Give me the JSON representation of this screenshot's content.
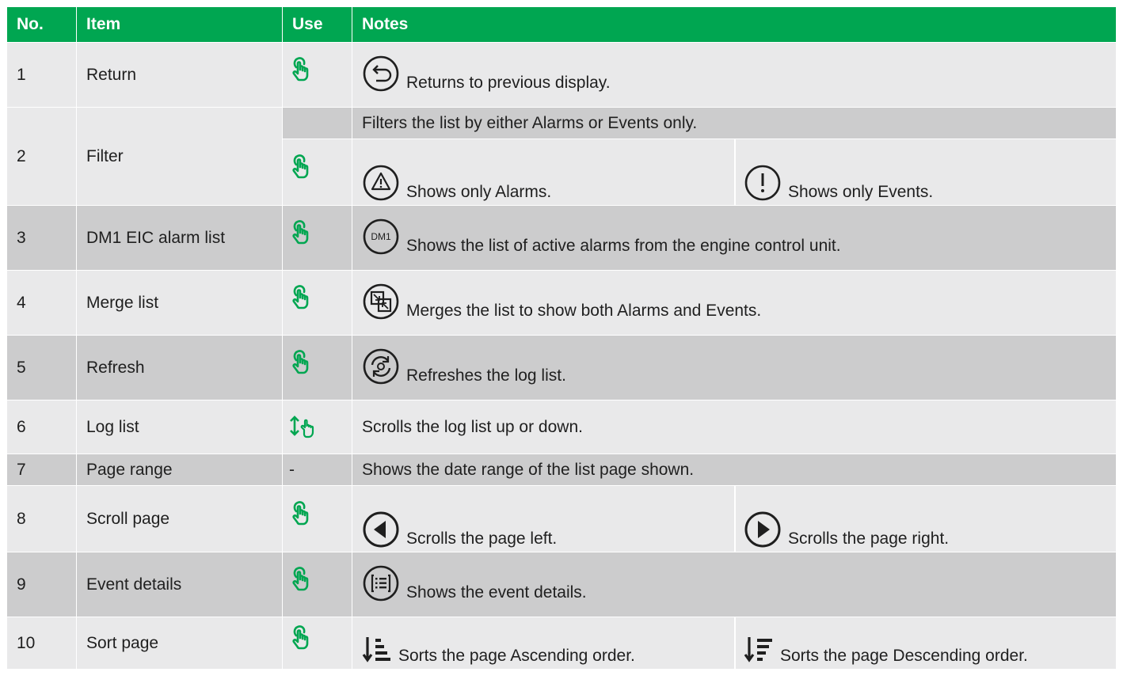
{
  "headers": {
    "no": "No.",
    "item": "Item",
    "use": "Use",
    "notes": "Notes"
  },
  "rows": {
    "r1": {
      "no": "1",
      "item": "Return",
      "use_icon": "tap-icon",
      "note_icon": "return-icon",
      "note": "Returns to previous display."
    },
    "r2": {
      "no": "2",
      "item": "Filter",
      "note_top": "Filters the list by either Alarms or Events only.",
      "use_icon": "tap-icon",
      "note_left_icon": "alarm-triangle-icon",
      "note_left": "Shows only Alarms.",
      "note_right_icon": "event-exclamation-icon",
      "note_right": "Shows only Events."
    },
    "r3": {
      "no": "3",
      "item": "DM1 EIC alarm list",
      "use_icon": "tap-icon",
      "note_icon": "dm1-icon",
      "icon_text": "DM1",
      "note": "Shows the list of active alarms from the engine control unit."
    },
    "r4": {
      "no": "4",
      "item": "Merge list",
      "use_icon": "tap-icon",
      "note_icon": "merge-icon",
      "note": "Merges the list to show both Alarms and Events."
    },
    "r5": {
      "no": "5",
      "item": "Refresh",
      "use_icon": "tap-icon",
      "note_icon": "refresh-icon",
      "note": "Refreshes the log list."
    },
    "r6": {
      "no": "6",
      "item": "Log list",
      "use_icon": "swipe-icon",
      "note": "Scrolls the log list up or down."
    },
    "r7": {
      "no": "7",
      "item": "Page range",
      "use": "-",
      "note": "Shows the date range of the list page shown."
    },
    "r8": {
      "no": "8",
      "item": "Scroll page",
      "use_icon": "tap-icon",
      "note_left_icon": "left-arrow-icon",
      "note_left": "Scrolls the page left.",
      "note_right_icon": "right-arrow-icon",
      "note_right": "Scrolls the page right."
    },
    "r9": {
      "no": "9",
      "item": "Event details",
      "use_icon": "tap-icon",
      "note_icon": "details-icon",
      "note": "Shows the event details."
    },
    "r10": {
      "no": "10",
      "item": "Sort page",
      "use_icon": "tap-icon",
      "note_left_icon": "sort-ascending-icon",
      "note_left": "Sorts the page Ascending order.",
      "note_right_icon": "sort-descending-icon",
      "note_right": "Sorts the page Descending order."
    }
  },
  "colors": {
    "header_green": "#00a651",
    "row_light": "#e9e9ea",
    "row_dark": "#cccccd",
    "icon_green": "#00a651"
  }
}
